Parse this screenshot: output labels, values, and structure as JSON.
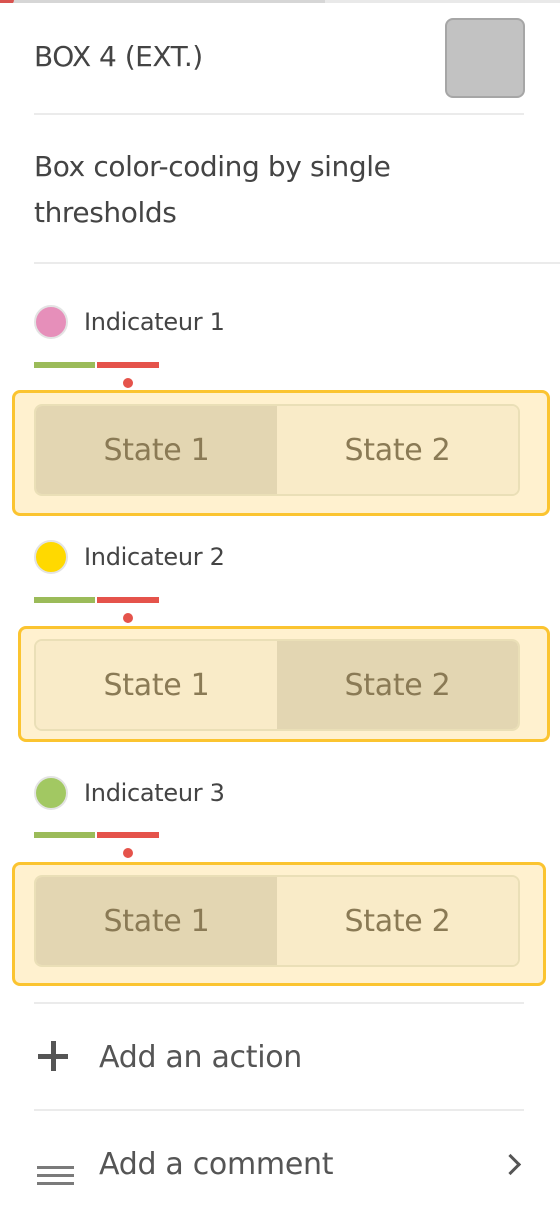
{
  "header": {
    "title": "BOX 4 (EXT.)",
    "swatch_color": "#c2c2c2",
    "swatch_icon": "color-swatch"
  },
  "description": "Box color-coding by single thresholds",
  "colors": {
    "threshold_low": "#9bbb59",
    "threshold_high": "#e5534b",
    "threshold_marker": "#e5534b",
    "state_box_border": "#fbc430",
    "state_box_bg": "#fff1cf",
    "state_active_bg": "#e3d6b2",
    "state_inactive_bg": "#f9ebc8"
  },
  "indicators": [
    {
      "label": "Indicateur 1",
      "color": "#e68fba",
      "states": [
        {
          "label": "State 1",
          "selected": true
        },
        {
          "label": "State 2",
          "selected": false
        }
      ]
    },
    {
      "label": "Indicateur 2",
      "color": "#ffd900",
      "states": [
        {
          "label": "State 1",
          "selected": false
        },
        {
          "label": "State 2",
          "selected": true
        }
      ]
    },
    {
      "label": "Indicateur 3",
      "color": "#a2c862",
      "states": [
        {
          "label": "State 1",
          "selected": true
        },
        {
          "label": "State 2",
          "selected": false
        }
      ]
    }
  ],
  "actions": {
    "add_action": {
      "label": "Add an action",
      "icon": "plus"
    },
    "add_comment": {
      "label": "Add a comment",
      "icon": "menu-lines",
      "trailing_icon": "chevron-right"
    }
  }
}
